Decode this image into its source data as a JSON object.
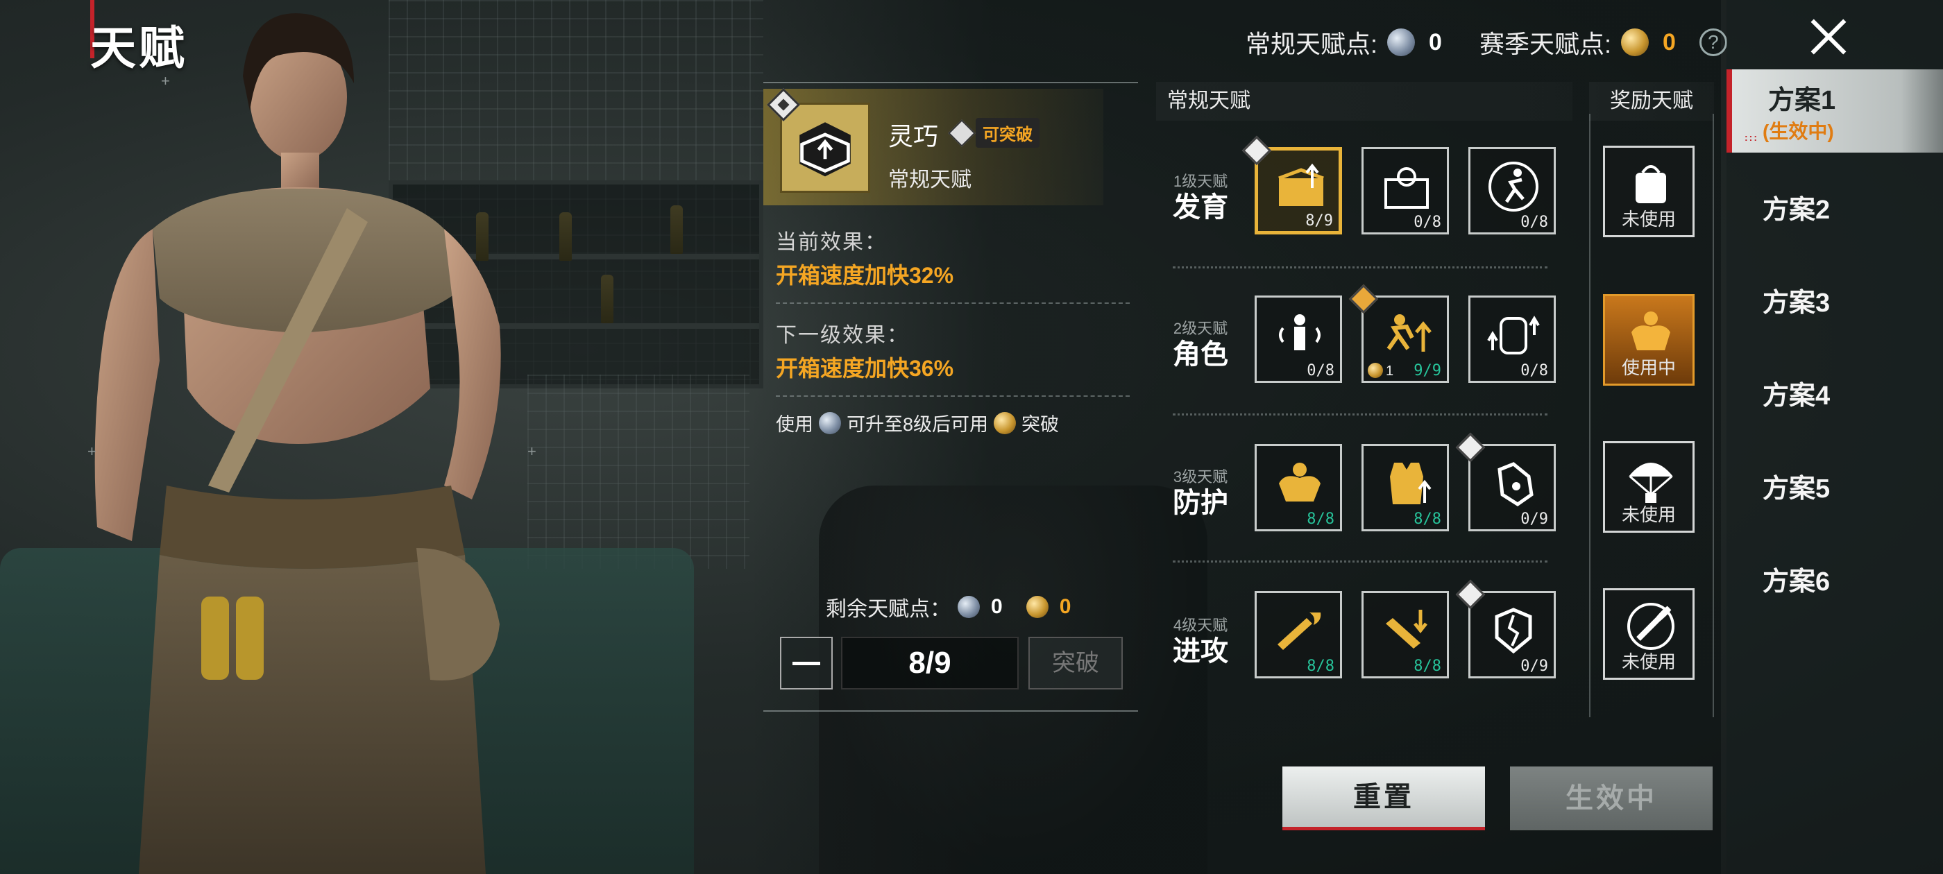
{
  "page": {
    "title": "天赋"
  },
  "header": {
    "regular_points_label": "常规天赋点:",
    "regular_points_value": "0",
    "season_points_label": "赛季天赋点:",
    "season_points_value": "0",
    "help_label": "?"
  },
  "detail": {
    "name": "灵巧",
    "badge": "可突破",
    "type": "常规天赋",
    "current_label": "当前效果：",
    "current_value": "开箱速度加快32%",
    "next_label": "下一级效果：",
    "next_value": "开箱速度加快36%",
    "note_prefix": "使用",
    "note_middle": "可升至8级后可用",
    "note_suffix": "突破",
    "remaining_label": "剩余天赋点：",
    "remaining_silver": "0",
    "remaining_gold": "0",
    "level": "8/9",
    "break_button": "突破"
  },
  "talents": {
    "header_regular": "常规天赋",
    "header_reward": "奖励天赋",
    "rows": [
      {
        "level_label": "1级天赋",
        "name": "发育",
        "tiles": [
          {
            "icon": "supply-box-icon",
            "count": "8/9",
            "green": false
          },
          {
            "icon": "loot-crate-icon",
            "count": "0/8",
            "green": false
          },
          {
            "icon": "runner-icon",
            "count": "0/8",
            "green": false
          }
        ],
        "reward_label": "未使用",
        "reward_icon": "bag-icon"
      },
      {
        "level_label": "2级天赋",
        "name": "角色",
        "tiles": [
          {
            "icon": "soldier-sound-icon",
            "count": "0/8",
            "green": false
          },
          {
            "icon": "sprint-icon",
            "count": "9/9",
            "green": true,
            "coin": "1"
          },
          {
            "icon": "backpack-up-icon",
            "count": "0/8",
            "green": false
          }
        ],
        "reward_label": "使用中",
        "reward_icon": "muscle-icon"
      },
      {
        "level_label": "3级天赋",
        "name": "防护",
        "tiles": [
          {
            "icon": "strength-icon",
            "count": "8/8",
            "green": true
          },
          {
            "icon": "vest-icon",
            "count": "8/8",
            "green": true
          },
          {
            "icon": "glove-icon",
            "count": "0/9",
            "green": false
          }
        ],
        "reward_label": "未使用",
        "reward_icon": "parachute-icon"
      },
      {
        "level_label": "4级天赋",
        "name": "进攻",
        "tiles": [
          {
            "icon": "rifle-fire-icon",
            "count": "8/8",
            "green": true
          },
          {
            "icon": "rifle-down-icon",
            "count": "8/8",
            "green": true
          },
          {
            "icon": "shield-break-icon",
            "count": "0/9",
            "green": false
          }
        ],
        "reward_label": "未使用",
        "reward_icon": "bullet-icon"
      }
    ]
  },
  "schemes": {
    "items": [
      "方案1",
      "方案2",
      "方案3",
      "方案4",
      "方案5",
      "方案6"
    ],
    "active_status": "(生效中)"
  },
  "buttons": {
    "reset": "重置",
    "active": "生效中"
  },
  "colors": {
    "accent_orange": "#f5a623",
    "accent_red": "#c4232a",
    "gold": "#e9b43a",
    "green": "#27c39a"
  }
}
